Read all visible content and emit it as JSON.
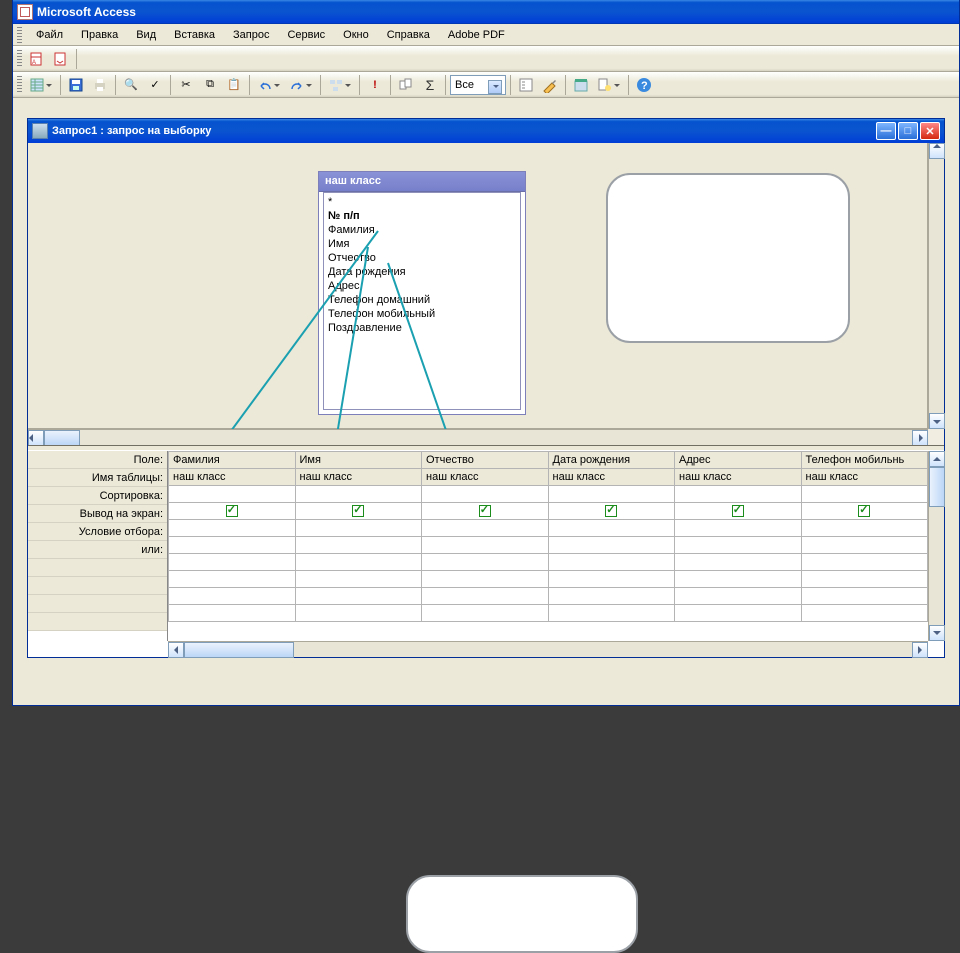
{
  "apptitle": "Microsoft Access",
  "menus": [
    "Файл",
    "Правка",
    "Вид",
    "Вставка",
    "Запрос",
    "Сервис",
    "Окно",
    "Справка",
    "Adobe PDF"
  ],
  "toolbar2": {
    "combo": "Все"
  },
  "sigma": "Σ",
  "subwin_title": "Запрос1 : запрос на выборку",
  "table": {
    "title": "наш класс",
    "fields": [
      "*",
      "№ п/п",
      "Фамилия",
      "Имя",
      "Отчество",
      "Дата рождения",
      "Адрес",
      "Телефон домашний",
      "Телефон мобильный",
      "Поздравление"
    ]
  },
  "qbe_labels": [
    "Поле:",
    "Имя таблицы:",
    "Сортировка:",
    "Вывод на экран:",
    "Условие отбора:",
    "или:"
  ],
  "cols": [
    {
      "field": "Фамилия",
      "table": "наш класс",
      "show": true
    },
    {
      "field": "Имя",
      "table": "наш класс",
      "show": true
    },
    {
      "field": "Отчество",
      "table": "наш класс",
      "show": true
    },
    {
      "field": "Дата рождения",
      "table": "наш класс",
      "show": true
    },
    {
      "field": "Адрес",
      "table": "наш класс",
      "show": true
    },
    {
      "field": "Телефон мобильнь",
      "table": "наш класс",
      "show": true
    }
  ]
}
